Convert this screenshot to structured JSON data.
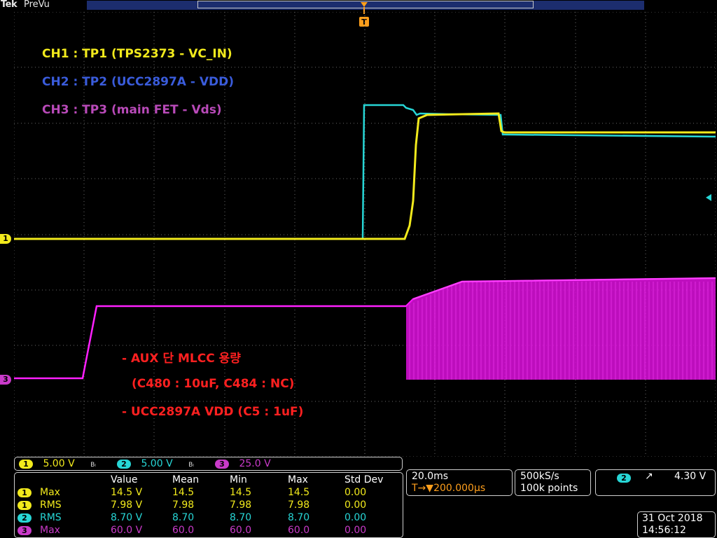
{
  "top_bar": {
    "brand": "Tek",
    "mode": "PreVu",
    "trigger_marker": "T"
  },
  "annotations": {
    "ch1": "CH1 : TP1 (TPS2373 - VC_IN)",
    "ch2": "CH2 : TP2 (UCC2897A - VDD)",
    "ch3": "CH3 : TP3 (main FET - Vds)",
    "note1": "- AUX 단 MLCC 용량",
    "note2": "(C480 : 10uF, C484 : NC)",
    "note3": "- UCC2897A VDD (C5 : 1uF)"
  },
  "channel_markers": {
    "ch1": "1",
    "ch3": "3"
  },
  "channel_scales": [
    {
      "channel": "1",
      "scale": "5.00 V",
      "bw": "Bₗ",
      "color": "#f2ea1c"
    },
    {
      "channel": "2",
      "scale": "5.00 V",
      "bw": "Bₗ",
      "color": "#27d6d6"
    },
    {
      "channel": "3",
      "scale": "25.0 V",
      "bw": "",
      "color": "#c93ac9"
    }
  ],
  "measurements": {
    "headers": [
      "Value",
      "Mean",
      "Min",
      "Max",
      "Std Dev"
    ],
    "rows": [
      {
        "channel": "1",
        "name": "Max",
        "value": "14.5 V",
        "mean": "14.5",
        "min": "14.5",
        "max": "14.5",
        "stddev": "0.00"
      },
      {
        "channel": "1",
        "name": "RMS",
        "value": "7.98 V",
        "mean": "7.98",
        "min": "7.98",
        "max": "7.98",
        "stddev": "0.00"
      },
      {
        "channel": "2",
        "name": "RMS",
        "value": "8.70 V",
        "mean": "8.70",
        "min": "8.70",
        "max": "8.70",
        "stddev": "0.00"
      },
      {
        "channel": "3",
        "name": "Max",
        "value": "60.0 V",
        "mean": "60.0",
        "min": "60.0",
        "max": "60.0",
        "stddev": "0.00"
      }
    ]
  },
  "timebase": {
    "scale": "20.0ms",
    "delay": "200.000µs",
    "delay_prefix": "T→▼"
  },
  "acquisition": {
    "sample_rate": "500kS/s",
    "record_length": "100k points"
  },
  "trigger": {
    "channel": "2",
    "slope": "↗",
    "level": "4.30 V"
  },
  "datetime": {
    "date": "31 Oct 2018",
    "time": "14:56:12"
  },
  "colors": {
    "ch1": "#f2ea1c",
    "ch2": "#27d6d6",
    "ch3": "#c93ac9",
    "ch3_trace": "#ff20ff",
    "grid": "#6a6a6a",
    "trigger": "#ff9f1c",
    "annotation_red": "#ff2020"
  }
}
